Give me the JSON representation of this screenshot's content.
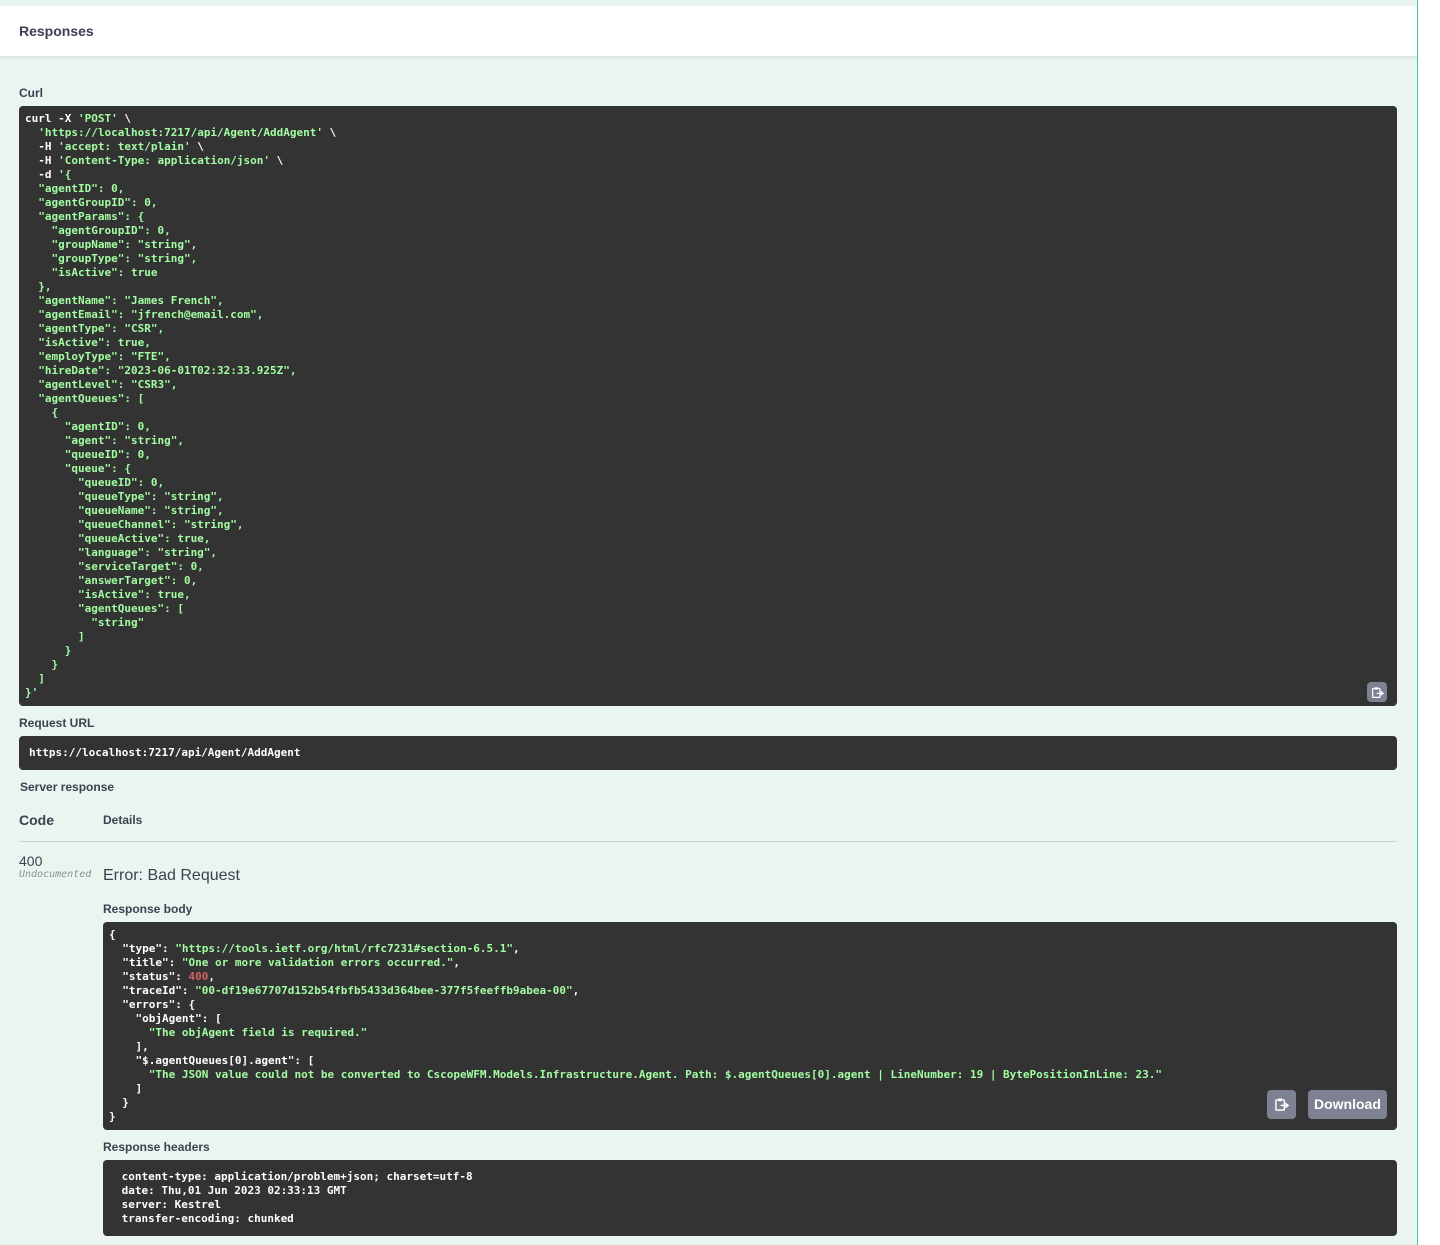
{
  "responses_header": {
    "title": "Responses"
  },
  "curl": {
    "label": "Curl",
    "command": [
      [
        [
          "",
          "curl -X "
        ],
        [
          "str",
          "'POST'"
        ],
        [
          "",
          " \\"
        ]
      ],
      [
        [
          "",
          "  "
        ],
        [
          "str",
          "'https://localhost:7217/api/Agent/AddAgent'"
        ],
        [
          "",
          " \\"
        ]
      ],
      [
        [
          "",
          "  -H "
        ],
        [
          "str",
          "'accept: text/plain'"
        ],
        [
          "",
          " \\"
        ]
      ],
      [
        [
          "",
          "  -H "
        ],
        [
          "str",
          "'Content-Type: application/json'"
        ],
        [
          "",
          " \\"
        ]
      ],
      [
        [
          "",
          "  -d "
        ],
        [
          "str",
          "'{"
        ]
      ],
      [
        [
          "str",
          "  \"agentID\": 0,"
        ]
      ],
      [
        [
          "str",
          "  \"agentGroupID\": 0,"
        ]
      ],
      [
        [
          "str",
          "  \"agentParams\": {"
        ]
      ],
      [
        [
          "str",
          "    \"agentGroupID\": 0,"
        ]
      ],
      [
        [
          "str",
          "    \"groupName\": \"string\","
        ]
      ],
      [
        [
          "str",
          "    \"groupType\": \"string\","
        ]
      ],
      [
        [
          "str",
          "    \"isActive\": true"
        ]
      ],
      [
        [
          "str",
          "  },"
        ]
      ],
      [
        [
          "str",
          "  \"agentName\": \"James French\","
        ]
      ],
      [
        [
          "str",
          "  \"agentEmail\": \"jfrench@email.com\","
        ]
      ],
      [
        [
          "str",
          "  \"agentType\": \"CSR\","
        ]
      ],
      [
        [
          "str",
          "  \"isActive\": true,"
        ]
      ],
      [
        [
          "str",
          "  \"employType\": \"FTE\","
        ]
      ],
      [
        [
          "str",
          "  \"hireDate\": \"2023-06-01T02:32:33.925Z\","
        ]
      ],
      [
        [
          "str",
          "  \"agentLevel\": \"CSR3\","
        ]
      ],
      [
        [
          "str",
          "  \"agentQueues\": ["
        ]
      ],
      [
        [
          "str",
          "    {"
        ]
      ],
      [
        [
          "str",
          "      \"agentID\": 0,"
        ]
      ],
      [
        [
          "str",
          "      \"agent\": \"string\","
        ]
      ],
      [
        [
          "str",
          "      \"queueID\": 0,"
        ]
      ],
      [
        [
          "str",
          "      \"queue\": {"
        ]
      ],
      [
        [
          "str",
          "        \"queueID\": 0,"
        ]
      ],
      [
        [
          "str",
          "        \"queueType\": \"string\","
        ]
      ],
      [
        [
          "str",
          "        \"queueName\": \"string\","
        ]
      ],
      [
        [
          "str",
          "        \"queueChannel\": \"string\","
        ]
      ],
      [
        [
          "str",
          "        \"queueActive\": true,"
        ]
      ],
      [
        [
          "str",
          "        \"language\": \"string\","
        ]
      ],
      [
        [
          "str",
          "        \"serviceTarget\": 0,"
        ]
      ],
      [
        [
          "str",
          "        \"answerTarget\": 0,"
        ]
      ],
      [
        [
          "str",
          "        \"isActive\": true,"
        ]
      ],
      [
        [
          "str",
          "        \"agentQueues\": ["
        ]
      ],
      [
        [
          "str",
          "          \"string\""
        ]
      ],
      [
        [
          "str",
          "        ]"
        ]
      ],
      [
        [
          "str",
          "      }"
        ]
      ],
      [
        [
          "str",
          "    }"
        ]
      ],
      [
        [
          "str",
          "  ]"
        ]
      ],
      [
        [
          "str",
          "}'"
        ]
      ]
    ]
  },
  "request_url": {
    "label": "Request URL",
    "value": "https://localhost:7217/api/Agent/AddAgent"
  },
  "server_response": {
    "label": "Server response",
    "col_code": "Code",
    "col_details": "Details",
    "status_code": "400",
    "status_note": "Undocumented",
    "error_title": "Error: Bad Request",
    "body_label": "Response body",
    "body": [
      [
        [
          "",
          "{"
        ]
      ],
      [
        [
          "",
          "  \"type\": "
        ],
        [
          "str",
          "\"https://tools.ietf.org/html/rfc7231#section-6.5.1\""
        ],
        [
          "",
          ","
        ]
      ],
      [
        [
          "",
          "  \"title\": "
        ],
        [
          "str",
          "\"One or more validation errors occurred.\""
        ],
        [
          "",
          ","
        ]
      ],
      [
        [
          "",
          "  \"status\": "
        ],
        [
          "num",
          "400"
        ],
        [
          "",
          ","
        ]
      ],
      [
        [
          "",
          "  \"traceId\": "
        ],
        [
          "str",
          "\"00-df19e67707d152b54fbfb5433d364bee-377f5feeffb9abea-00\""
        ],
        [
          "",
          ","
        ]
      ],
      [
        [
          "",
          "  \"errors\": {"
        ]
      ],
      [
        [
          "",
          "    \"objAgent\": ["
        ]
      ],
      [
        [
          "",
          "      "
        ],
        [
          "str",
          "\"The objAgent field is required.\""
        ]
      ],
      [
        [
          "",
          "    ],"
        ]
      ],
      [
        [
          "",
          "    \"$.agentQueues[0].agent\": ["
        ]
      ],
      [
        [
          "",
          "      "
        ],
        [
          "str",
          "\"The JSON value could not be converted to CscopeWFM.Models.Infrastructure.Agent. Path: $.agentQueues[0].agent | LineNumber: 19 | BytePositionInLine: 23.\""
        ]
      ],
      [
        [
          "",
          "    ]"
        ]
      ],
      [
        [
          "",
          "  }"
        ]
      ],
      [
        [
          "",
          "}"
        ]
      ]
    ],
    "download_label": "Download",
    "headers_label": "Response headers",
    "headers": [
      " content-type: application/problem+json; charset=utf-8 ",
      " date: Thu,01 Jun 2023 02:33:13 GMT ",
      " server: Kestrel ",
      " transfer-encoding: chunked "
    ]
  },
  "icons": {
    "copy": "clipboard-copy-icon"
  },
  "colors": {
    "panel": "#eaf5ef",
    "code_bg": "#333333",
    "string": "#a2fca2",
    "number": "#d36363",
    "button": "#7d8293"
  }
}
